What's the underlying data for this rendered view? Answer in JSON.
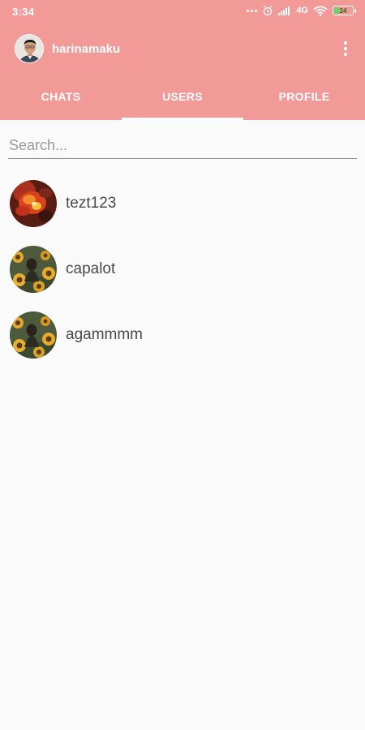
{
  "status_bar": {
    "time": "3:34",
    "network": "4G",
    "battery_level": "24"
  },
  "toolbar": {
    "username": "harinamaku",
    "menu_icon": "more-vert-icon"
  },
  "tabs": [
    {
      "label": "CHATS",
      "active": false
    },
    {
      "label": "USERS",
      "active": true
    },
    {
      "label": "PROFILE",
      "active": false
    }
  ],
  "search": {
    "placeholder": "Search...",
    "value": ""
  },
  "users": [
    {
      "name": "tezt123",
      "avatar": "red-flower-avatar"
    },
    {
      "name": "capalot",
      "avatar": "sunflower-avatar"
    },
    {
      "name": "agammmm",
      "avatar": "sunflower-avatar"
    }
  ],
  "colors": {
    "primary": "#f29a98",
    "background": "#fafafa",
    "text": "#4a4a4a"
  }
}
